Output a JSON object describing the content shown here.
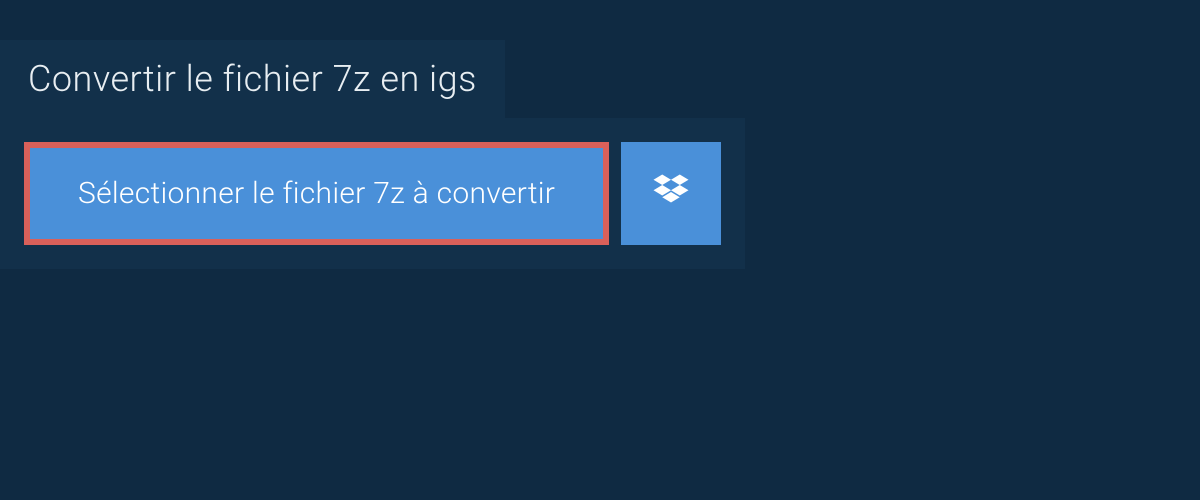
{
  "heading": "Convertir le fichier 7z en igs",
  "select_button_label": "Sélectionner le fichier 7z à convertir",
  "dropbox_icon": "dropbox"
}
